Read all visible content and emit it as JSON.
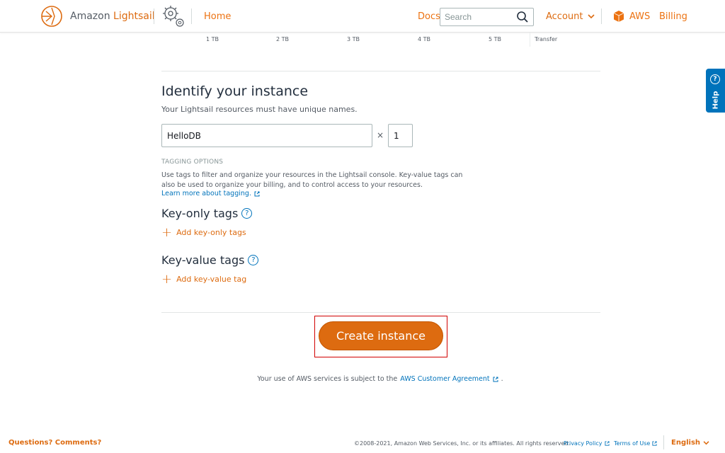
{
  "header": {
    "logo_prefix": "Amazon",
    "logo_brand": "Lightsail",
    "home": "Home",
    "docs": "Docs",
    "search_placeholder": "Search",
    "account": "Account",
    "aws": "AWS",
    "billing": "Billing"
  },
  "transfer": {
    "ticks": [
      "1 TB",
      "2 TB",
      "3 TB",
      "4 TB",
      "5 TB"
    ],
    "label": "Transfer"
  },
  "identify": {
    "title": "Identify your instance",
    "subtitle": "Your Lightsail resources must have unique names.",
    "name_value": "HelloDB",
    "times": "×",
    "count_value": "1"
  },
  "tagging": {
    "heading": "TAGGING OPTIONS",
    "description": "Use tags to filter and organize your resources in the Lightsail console. Key-value tags can also be used to organize your billing, and to control access to your resources.",
    "learn_more": "Learn more about tagging.",
    "key_only_title": "Key-only tags",
    "add_key_only": "Add key-only tags",
    "key_value_title": "Key-value tags",
    "add_key_value": "Add key-value tag",
    "help_glyph": "?"
  },
  "create_button": "Create instance",
  "agreement": {
    "text": "Your use of AWS services is subject to the",
    "link": "AWS Customer Agreement",
    "end": "."
  },
  "footer": {
    "questions": "Questions? Comments?",
    "copyright": "©2008-2021, Amazon Web Services, Inc. or its affiliates. All rights reserved.",
    "privacy": "Privacy Policy",
    "terms": "Terms of Use",
    "language": "English"
  },
  "help_tab": {
    "label": "Help",
    "glyph": "?"
  },
  "colors": {
    "accent": "#dd6b10",
    "link": "#0073bb",
    "highlight": "#d10000"
  },
  "icons": [
    "lightsail-logo-icon",
    "gear-icon",
    "search-icon",
    "chevron-down-icon",
    "aws-cube-icon",
    "external-link-icon",
    "plus-icon",
    "help-icon"
  ]
}
